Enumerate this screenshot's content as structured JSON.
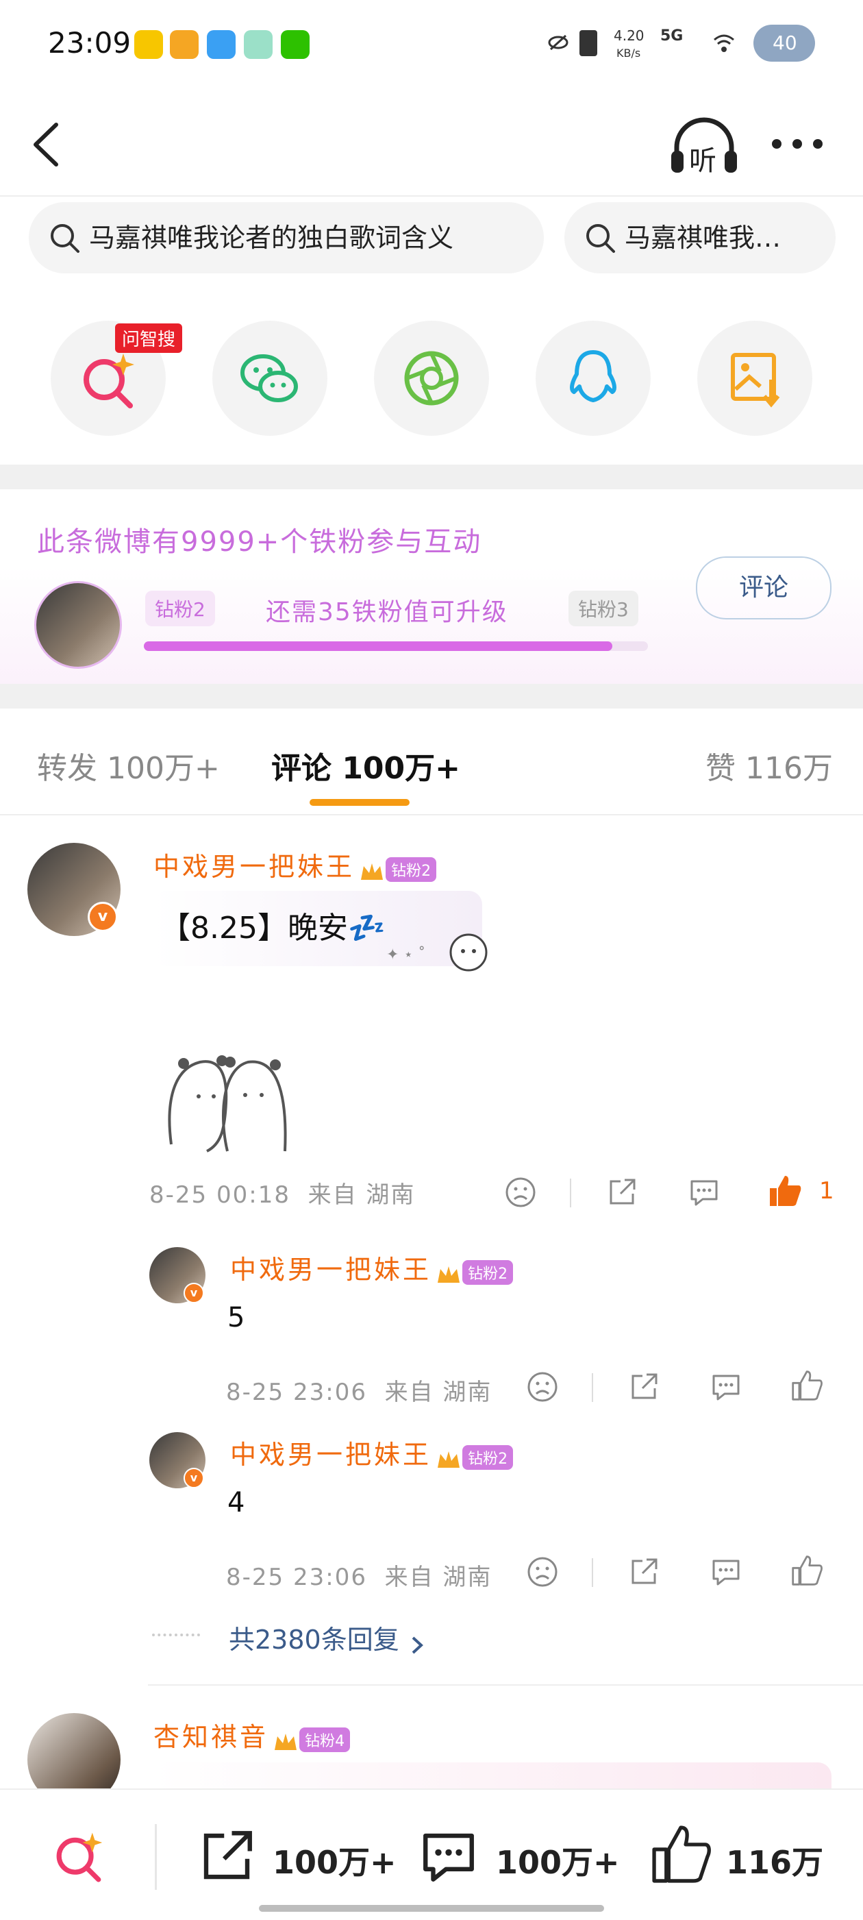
{
  "status_bar": {
    "time": "23:09",
    "net_speed": "4.20",
    "net_unit": "KB/s",
    "network": "5G",
    "battery": "40"
  },
  "nav": {
    "listen_label": "听"
  },
  "search_pills": [
    "马嘉祺唯我论者的独白歌词含义",
    "马嘉祺唯我…"
  ],
  "share": {
    "ai_badge": "问智搜"
  },
  "fans": {
    "headline": "此条微博有9999+个铁粉参与互动",
    "level_current": "钻粉2",
    "level_next": "钻粉3",
    "upgrade_text": "还需35铁粉值可升级",
    "progress": 0.93,
    "comment_button": "评论"
  },
  "tabs": {
    "repost": "转发 100万+",
    "comment": "评论 100万+",
    "like": "赞 116万"
  },
  "comments": [
    {
      "user": "中戏男一把妹王",
      "badge": "钻粉2",
      "text": "【8.25】晚安💤",
      "time": "8-25 00:18",
      "location": "来自 湖南",
      "likes": "1"
    }
  ],
  "replies": [
    {
      "user": "中戏男一把妹王",
      "badge": "钻粉2",
      "text": "5",
      "time": "8-25 23:06",
      "location": "来自 湖南"
    },
    {
      "user": "中戏男一把妹王",
      "badge": "钻粉2",
      "text": "4",
      "time": "8-25 23:06",
      "location": "来自 湖南"
    }
  ],
  "more_replies": "共2380条回复",
  "next_comment": {
    "user": "杏知祺音",
    "badge": "钻粉4"
  },
  "bottom_bar": {
    "repost": "100万+",
    "comment": "100万+",
    "like": "116万"
  },
  "colors": {
    "brand_orange": "#f06a0e",
    "fan_purple": "#c86cdc",
    "link_blue": "#3b5b8a"
  }
}
